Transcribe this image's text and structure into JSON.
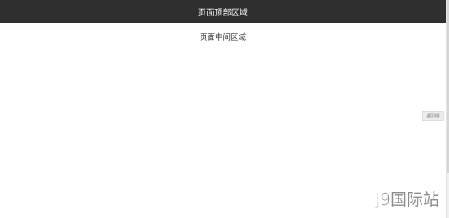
{
  "header": {
    "title": "页面顶部区域",
    "background": "#2f2f2f",
    "text_color": "#ffffff"
  },
  "main": {
    "title": "页面中间区域"
  },
  "controls": {
    "back_to_top_label": "返回顶部"
  },
  "watermark": {
    "text": "J9国际站"
  }
}
